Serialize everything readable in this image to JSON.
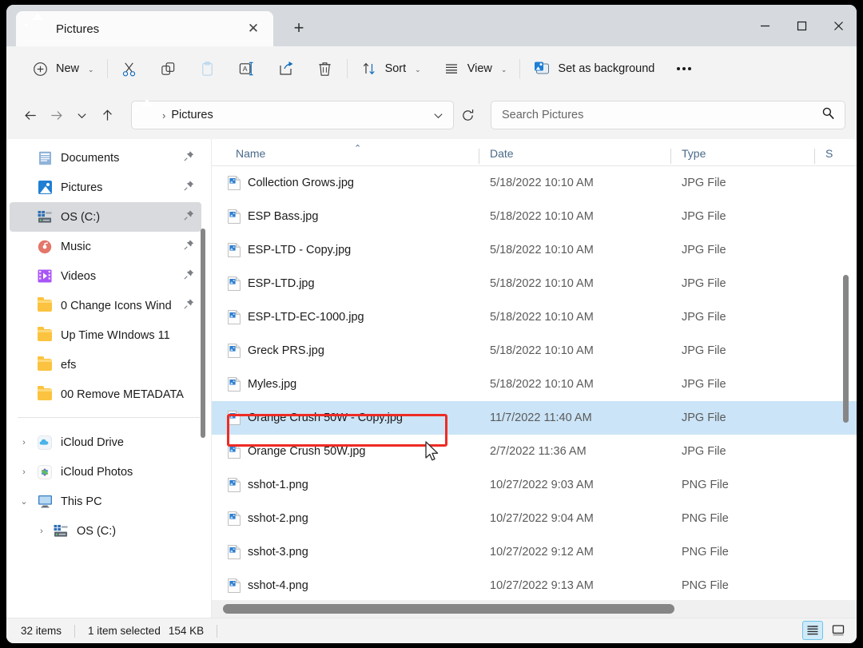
{
  "window": {
    "tab_title": "Pictures",
    "tab_close_glyph": "✕",
    "new_tab_glyph": "+",
    "minimize_label": "Minimize",
    "maximize_label": "Maximize",
    "close_label": "Close"
  },
  "toolbar": {
    "new_label": "New",
    "new_chevron": "⌄",
    "cut_label": "Cut",
    "copy_label": "Copy",
    "paste_label": "Paste",
    "rename_label": "Rename",
    "share_label": "Share",
    "delete_label": "Delete",
    "sort_label": "Sort",
    "sort_chevron": "⌄",
    "view_label": "View",
    "view_chevron": "⌄",
    "set_as_background_label": "Set as background",
    "more_label": "See more"
  },
  "address": {
    "back_label": "Back",
    "forward_label": "Forward",
    "recent_chevron": "⌄",
    "up_label": "Up",
    "breadcrumb_separator": "›",
    "path": "Pictures",
    "dropdown_chevron": "⌄",
    "refresh_label": "Refresh"
  },
  "search": {
    "placeholder": "Search Pictures",
    "value": "",
    "icon": "search-icon"
  },
  "sidebar": {
    "items": [
      {
        "label": "Documents",
        "icon": "documents-icon",
        "pinned": true,
        "selected": false,
        "expander": "",
        "child": false
      },
      {
        "label": "Pictures",
        "icon": "pictures-icon",
        "pinned": true,
        "selected": false,
        "expander": "",
        "child": false
      },
      {
        "label": "OS (C:)",
        "icon": "drive-icon",
        "pinned": true,
        "selected": true,
        "expander": "",
        "child": false
      },
      {
        "label": "Music",
        "icon": "music-icon",
        "pinned": true,
        "selected": false,
        "expander": "",
        "child": false
      },
      {
        "label": "Videos",
        "icon": "videos-icon",
        "pinned": true,
        "selected": false,
        "expander": "",
        "child": false
      },
      {
        "label": "0 Change Icons Wind",
        "icon": "folder-icon",
        "pinned": true,
        "selected": false,
        "expander": "",
        "child": false
      },
      {
        "label": "Up Time WIndows 11",
        "icon": "folder-icon",
        "pinned": false,
        "selected": false,
        "expander": "",
        "child": false
      },
      {
        "label": "efs",
        "icon": "folder-icon",
        "pinned": false,
        "selected": false,
        "expander": "",
        "child": false
      },
      {
        "label": "00 Remove METADATA",
        "icon": "folder-icon",
        "pinned": false,
        "selected": false,
        "expander": "",
        "child": false
      }
    ],
    "tree": [
      {
        "label": "iCloud Drive",
        "icon": "icloud-drive-icon",
        "expander": "›",
        "child": false
      },
      {
        "label": "iCloud Photos",
        "icon": "icloud-photos-icon",
        "expander": "›",
        "child": false
      },
      {
        "label": "This PC",
        "icon": "this-pc-icon",
        "expander": "⌄",
        "child": false
      },
      {
        "label": "OS (C:)",
        "icon": "drive-icon",
        "expander": "›",
        "child": true
      }
    ]
  },
  "columns": {
    "name": "Name",
    "date": "Date",
    "type": "Type",
    "size": "S",
    "sort_indicator": "⌃"
  },
  "files": [
    {
      "name": "Collection Grows.jpg",
      "date": "5/18/2022 10:10 AM",
      "type": "JPG File",
      "selected": false
    },
    {
      "name": "ESP Bass.jpg",
      "date": "5/18/2022 10:10 AM",
      "type": "JPG File",
      "selected": false
    },
    {
      "name": "ESP-LTD - Copy.jpg",
      "date": "5/18/2022 10:10 AM",
      "type": "JPG File",
      "selected": false
    },
    {
      "name": "ESP-LTD.jpg",
      "date": "5/18/2022 10:10 AM",
      "type": "JPG File",
      "selected": false
    },
    {
      "name": "ESP-LTD-EC-1000.jpg",
      "date": "5/18/2022 10:10 AM",
      "type": "JPG File",
      "selected": false
    },
    {
      "name": "Greck PRS.jpg",
      "date": "5/18/2022 10:10 AM",
      "type": "JPG File",
      "selected": false
    },
    {
      "name": "Myles.jpg",
      "date": "5/18/2022 10:10 AM",
      "type": "JPG File",
      "selected": false
    },
    {
      "name": "Orange Crush 50W - Copy.jpg",
      "date": "11/7/2022 11:40 AM",
      "type": "JPG File",
      "selected": true
    },
    {
      "name": "Orange Crush 50W.jpg",
      "date": "2/7/2022 11:36 AM",
      "type": "JPG File",
      "selected": false
    },
    {
      "name": "sshot-1.png",
      "date": "10/27/2022 9:03 AM",
      "type": "PNG File",
      "selected": false
    },
    {
      "name": "sshot-2.png",
      "date": "10/27/2022 9:04 AM",
      "type": "PNG File",
      "selected": false
    },
    {
      "name": "sshot-3.png",
      "date": "10/27/2022 9:12 AM",
      "type": "PNG File",
      "selected": false
    },
    {
      "name": "sshot-4.png",
      "date": "10/27/2022 9:13 AM",
      "type": "PNG File",
      "selected": false
    }
  ],
  "status": {
    "item_count": "32 items",
    "selection": "1 item selected",
    "size": "154 KB",
    "details_view_label": "Details view",
    "large_icons_view_label": "Large icons view"
  },
  "colors": {
    "accent": "#0f6cbd",
    "selection": "#cbe4f7",
    "annotation": "#ee2b24",
    "folder": "#fbc33f",
    "header_text": "#4a6a8a"
  }
}
